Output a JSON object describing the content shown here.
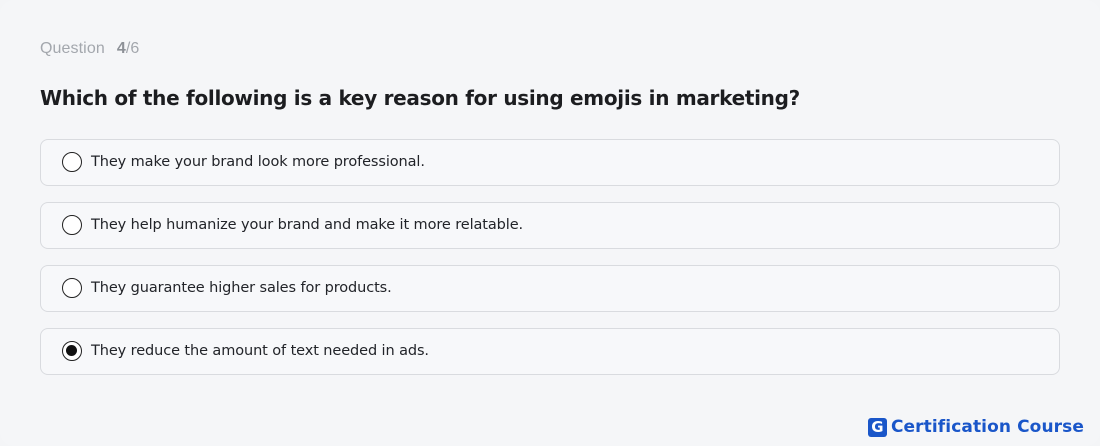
{
  "quiz": {
    "counter_label": "Question",
    "current": "4",
    "total": "/6",
    "question": "Which of the following is a key reason for using emojis in marketing?",
    "options": [
      {
        "text": "They make your brand look more professional.",
        "selected": false
      },
      {
        "text": "They help humanize your brand and make it more relatable.",
        "selected": false
      },
      {
        "text": "They guarantee higher sales for products.",
        "selected": false
      },
      {
        "text": "They reduce the amount of text needed in ads.",
        "selected": true
      }
    ]
  },
  "brand": {
    "logo_letter": "G",
    "name": "Certification Course",
    "color": "#1a56c9"
  }
}
